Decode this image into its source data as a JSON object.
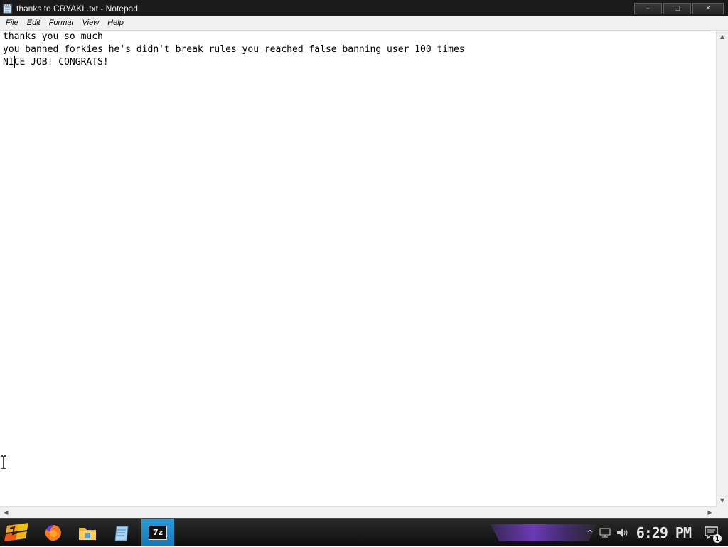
{
  "window": {
    "title": "thanks to CRYAKL.txt - Notepad",
    "minimize_label": "–",
    "maximize_label": "□",
    "close_label": "✕"
  },
  "menu": {
    "items": [
      "File",
      "Edit",
      "Format",
      "View",
      "Help"
    ]
  },
  "document": {
    "lines": [
      "thanks you so much",
      "you banned forkies he's didn't break rules you reached false banning user 100 times",
      "NICE JOB! CONGRATS!"
    ]
  },
  "taskbar": {
    "pinned": [
      {
        "name": "start-button",
        "icon": "start-icon"
      },
      {
        "name": "firefox",
        "icon": "firefox-icon"
      },
      {
        "name": "file-explorer",
        "icon": "folder-icon"
      },
      {
        "name": "notepad",
        "icon": "notepad-icon"
      },
      {
        "name": "7zip",
        "icon": "7zip-icon",
        "label": "7z"
      }
    ],
    "tray": {
      "chevron": "^",
      "clock": "6:29 PM",
      "notification_count": "1"
    }
  },
  "colors": {
    "titlebar": "#1a1a1a",
    "taskbar": "#1b1b1b",
    "active_task": "#1f86c9",
    "accent_purple": "#7a3fd0"
  }
}
